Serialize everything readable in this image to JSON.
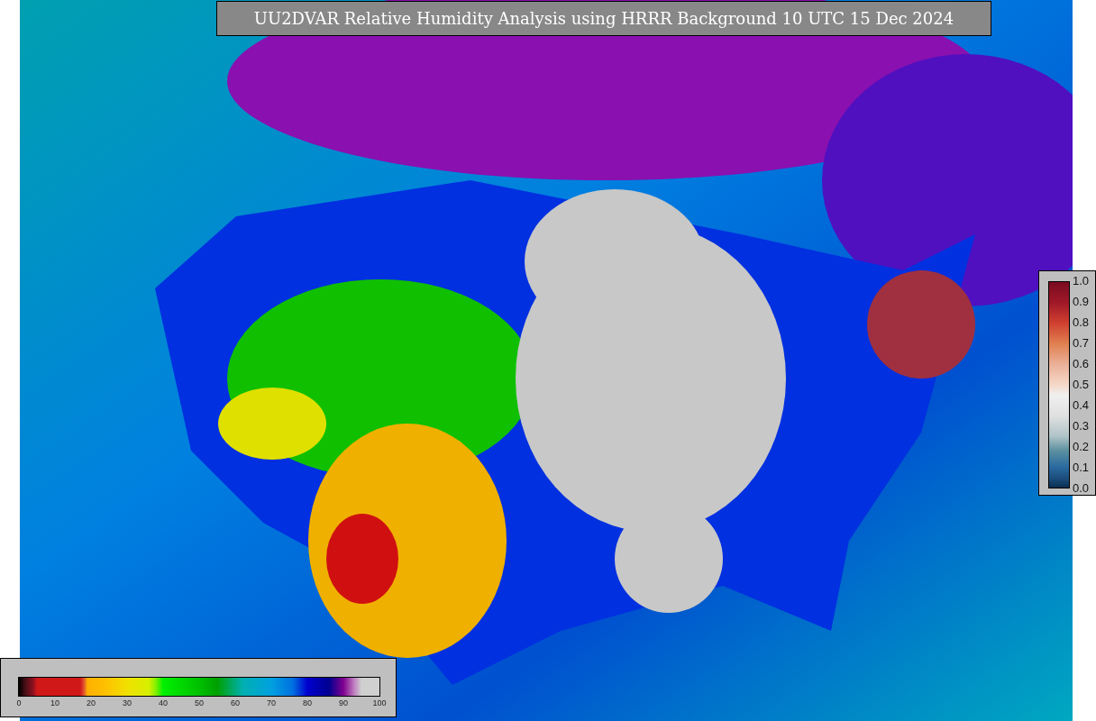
{
  "title": "UU2DVAR Relative Humidity Analysis using HRRR Background 10 UTC 15 Dec 2024",
  "humidity_colorbar": {
    "ticks": [
      "0",
      "10",
      "20",
      "30",
      "40",
      "50",
      "60",
      "70",
      "80",
      "90",
      "100"
    ]
  },
  "observation_colorbar": {
    "ticks": [
      "1.0",
      "0.9",
      "0.8",
      "0.7",
      "0.6",
      "0.5",
      "0.4",
      "0.3",
      "0.2",
      "0.1",
      "0.0"
    ]
  }
}
